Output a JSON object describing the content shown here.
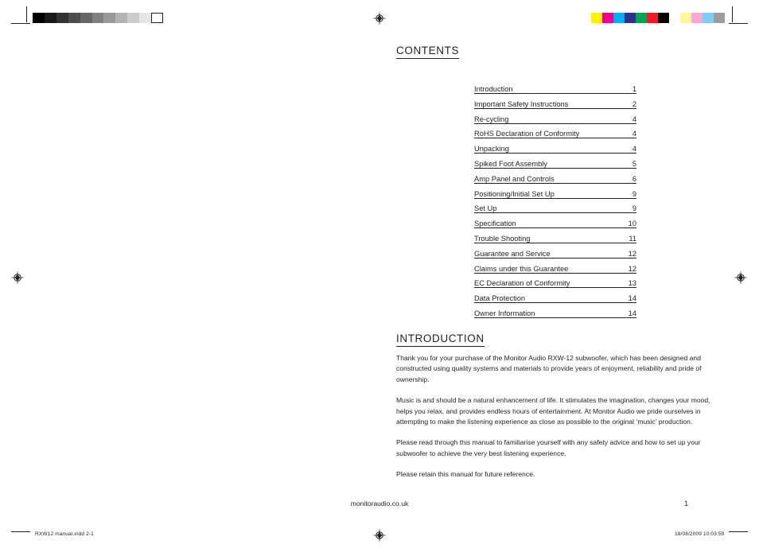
{
  "document": {
    "contents_heading": "CONTENTS",
    "introduction_heading": "INTRODUCTION",
    "toc": [
      {
        "label": "Introduction",
        "page": "1"
      },
      {
        "label": "Important Safety Instructions",
        "page": "2"
      },
      {
        "label": "Re-cycling",
        "page": "4"
      },
      {
        "label": "RoHS Declaration of Conformity",
        "page": "4"
      },
      {
        "label": "Unpacking",
        "page": "4"
      },
      {
        "label": "Spiked Foot Assembly",
        "page": "5"
      },
      {
        "label": "Amp Panel and Controls",
        "page": "6"
      },
      {
        "label": "Positioning/Initial Set Up",
        "page": "9"
      },
      {
        "label": "Set Up",
        "page": "9"
      },
      {
        "label": "Specification",
        "page": "10"
      },
      {
        "label": "Trouble Shooting",
        "page": "11"
      },
      {
        "label": "Guarantee and Service",
        "page": "12"
      },
      {
        "label": "Claims under this Guarantee",
        "page": "12"
      },
      {
        "label": "EC Declaration of Conformity",
        "page": "13"
      },
      {
        "label": "Data Protection",
        "page": "14"
      },
      {
        "label": "Owner Information",
        "page": "14"
      }
    ],
    "intro_paragraphs": [
      "Thank you for your purchase of the Monitor Audio RXW-12 subwoofer, which has been designed and constructed using quality systems and materials to provide years of enjoyment, reliability and pride of ownership.",
      "Music is and should be a natural enhancement of life. It stimulates the imagination, changes your mood, helps you relax, and provides endless hours of entertainment.  At Monitor Audio we pride ourselves in attempting to make the listening experience as close as possible to the original ‘music’ production.",
      "Please read through this manual to familiarise yourself with any safety advice and how to set up your subwoofer to achieve the very best listening experience.",
      "Please retain this manual for future reference."
    ],
    "footer": {
      "url": "monitoraudio.co.uk",
      "page_number": "1"
    },
    "print_meta": {
      "left": "RXW12 manual.indd   2-1",
      "right": "18/08/2009   10:03:59"
    }
  },
  "print_marks": {
    "greyscale_swatches": [
      "#000000",
      "#1a1a1a",
      "#333333",
      "#4d4d4d",
      "#666666",
      "#808080",
      "#999999",
      "#b3b3b3",
      "#cccccc",
      "#e6e6e6",
      "#ffffff"
    ],
    "color_swatches": [
      "#fff200",
      "#ec008c",
      "#00aeef",
      "#2e3192",
      "#00a651",
      "#ed1c24",
      "#000000",
      "#fff799",
      "#f9a8d4",
      "#7ecef4",
      "#808080"
    ],
    "registration_icon": "registration-target-icon"
  }
}
